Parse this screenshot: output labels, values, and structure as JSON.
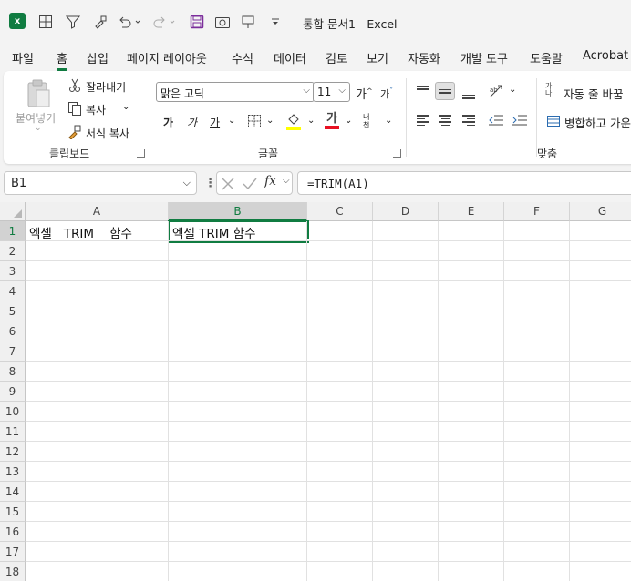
{
  "app": {
    "doc_title": "통합 문서1  -  Excel"
  },
  "quick_access": [
    "save-icon",
    "camera-icon",
    "presentation-icon",
    "customize-icon"
  ],
  "menu": {
    "tabs": [
      "파일",
      "홈",
      "삽입",
      "페이지 레이아웃",
      "수식",
      "데이터",
      "검토",
      "보기",
      "자동화",
      "개발 도구",
      "도움말",
      "Acrobat"
    ],
    "active": "홈"
  },
  "ribbon": {
    "clipboard": {
      "paste": "붙여넣기",
      "cut": "잘라내기",
      "copy": "복사",
      "format_painter": "서식 복사",
      "group_label": "클립보드"
    },
    "font": {
      "font_name": "맑은 고딕",
      "font_size": "11",
      "grow": "가",
      "shrink": "가",
      "bold": "가",
      "italic": "가",
      "underline": "가",
      "font_color": "가",
      "phonetic": "내천",
      "group_label": "글꼴",
      "fill_color": "#ffff00",
      "text_color": "#e81123"
    },
    "alignment": {
      "wrap_text": "자동 줄 바꿈",
      "merge": "병합하고 가운데",
      "group_label": "맞춤",
      "wrap_icon": "가나"
    }
  },
  "formula_bar": {
    "name_box": "B1",
    "formula": "=TRIM(A1)",
    "fx": "fx"
  },
  "sheet": {
    "columns": [
      "A",
      "B",
      "C",
      "D",
      "E",
      "F",
      "G"
    ],
    "rows": [
      "1",
      "2",
      "3",
      "4",
      "5",
      "6",
      "7",
      "8",
      "9",
      "10",
      "11",
      "12",
      "13",
      "14",
      "15",
      "16",
      "17",
      "18"
    ],
    "selected_cell": "B1",
    "cells": {
      "A1": "엑셀   TRIM    함수",
      "B1": "엑셀 TRIM 함수"
    },
    "accent": "#107c41"
  }
}
